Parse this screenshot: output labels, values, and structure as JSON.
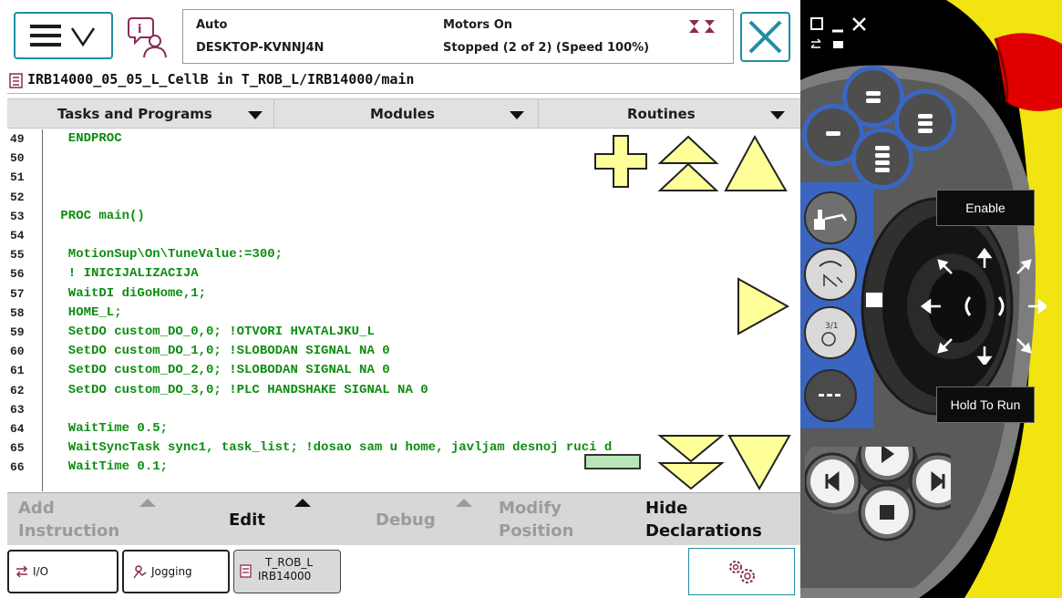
{
  "status": {
    "mode": "Auto",
    "host": "DESKTOP-KVNNJ4N",
    "motors": "Motors On",
    "state": "Stopped (2 of 2) (Speed 100%)"
  },
  "path": {
    "text": "IRB14000_05_05_L_CellB  in  T_ROB_L/IRB14000/main"
  },
  "tabs": [
    {
      "label": "Tasks and Programs"
    },
    {
      "label": "Modules"
    },
    {
      "label": "Routines"
    }
  ],
  "code_lines": [
    {
      "num": "49",
      "text": "  ENDPROC"
    },
    {
      "num": "50",
      "text": ""
    },
    {
      "num": "51",
      "text": ""
    },
    {
      "num": "52",
      "text": ""
    },
    {
      "num": "53",
      "text": " PROC main()"
    },
    {
      "num": "54",
      "text": ""
    },
    {
      "num": "55",
      "text": "  MotionSup\\On\\TuneValue:=300;"
    },
    {
      "num": "56",
      "text": "  ! INICIJALIZACIJA"
    },
    {
      "num": "57",
      "text": "  WaitDI diGoHome,1;"
    },
    {
      "num": "58",
      "text": "  HOME_L;"
    },
    {
      "num": "59",
      "text": "  SetDO custom_DO_0,0; !OTVORI HVATALJKU_L"
    },
    {
      "num": "60",
      "text": "  SetDO custom_DO_1,0; !SLOBODAN SIGNAL NA 0"
    },
    {
      "num": "61",
      "text": "  SetDO custom_DO_2,0; !SLOBODAN SIGNAL NA 0"
    },
    {
      "num": "62",
      "text": "  SetDO custom_DO_3,0; !PLC HANDSHAKE SIGNAL NA 0"
    },
    {
      "num": "63",
      "text": ""
    },
    {
      "num": "64",
      "text": "  WaitTime 0.5;"
    },
    {
      "num": "65",
      "text": "  WaitSyncTask sync1, task_list; !dosao sam u home, javljam desnoj ruci d"
    },
    {
      "num": "66",
      "text": "  WaitTime 0.1;"
    }
  ],
  "commands": {
    "add_instruction_1": "Add",
    "add_instruction_2": "Instruction",
    "edit": "Edit",
    "debug": "Debug",
    "modify_position_1": "Modify",
    "modify_position_2": "Position",
    "hide_declarations_1": "Hide",
    "hide_declarations_2": "Declarations"
  },
  "taskbar": {
    "io": "I/O",
    "jogging": "Jogging",
    "task_1": "T_ROB_L",
    "task_2": "IRB14000"
  },
  "pendant": {
    "enable": "Enable",
    "hold_to_run": "Hold To Run"
  },
  "colors": {
    "code": "#0d8d10",
    "accent": "#1f8ea3",
    "overlay_yellow": "#ffff99",
    "pendant_blue": "#3a66c2",
    "estop_red": "#e00000"
  }
}
